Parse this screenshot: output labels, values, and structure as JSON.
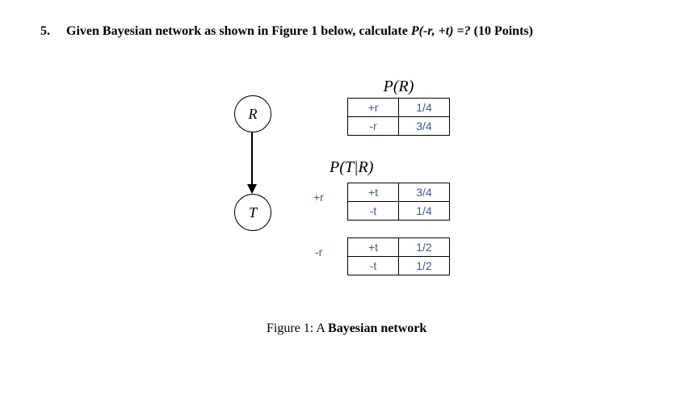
{
  "question": {
    "number": "5.",
    "text_prefix": "Given Bayesian network as shown in Figure 1 below, calculate ",
    "formula": "P(-r, +t) =?",
    "points": " (10 Points)"
  },
  "nodes": {
    "R": "R",
    "T": "T"
  },
  "pr": {
    "title": "P(R)",
    "rows": [
      {
        "label": "+r",
        "value": "1/4"
      },
      {
        "label": "-r",
        "value": "3/4"
      }
    ]
  },
  "ptr": {
    "title": "P(T|R)",
    "cond1": "+r",
    "cond2": "-r",
    "rows1": [
      {
        "label": "+t",
        "value": "3/4"
      },
      {
        "label": "-t",
        "value": "1/4"
      }
    ],
    "rows2": [
      {
        "label": "+t",
        "value": "1/2"
      },
      {
        "label": "-t",
        "value": "1/2"
      }
    ]
  },
  "caption": {
    "prefix": "Figure 1: A ",
    "bold": "Bayesian network"
  },
  "chart_data": {
    "type": "table",
    "description": "Bayesian network with node R parent of node T",
    "P_R": {
      "+r": 0.25,
      "-r": 0.75
    },
    "P_T_given_R": {
      "+r": {
        "+t": 0.75,
        "-t": 0.25
      },
      "-r": {
        "+t": 0.5,
        "-t": 0.5
      }
    }
  }
}
